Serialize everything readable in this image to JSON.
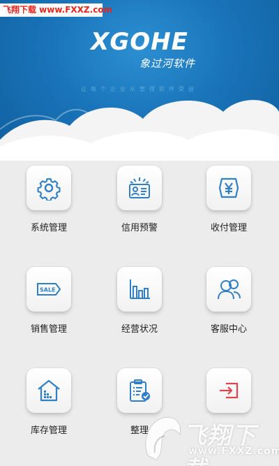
{
  "watermark_top": "飞翔下载 www.FXXZ.com",
  "header": {
    "logo": "XGOHE",
    "logo_sub": "象过河软件",
    "tagline": "让每个企业从管理软件受益"
  },
  "menu": [
    {
      "label": "系统管理",
      "icon": "gear-icon"
    },
    {
      "label": "信用预警",
      "icon": "credit-card-alert-icon"
    },
    {
      "label": "收付管理",
      "icon": "yen-payment-icon"
    },
    {
      "label": "销售管理",
      "icon": "sale-tag-icon"
    },
    {
      "label": "经营状况",
      "icon": "bar-chart-icon"
    },
    {
      "label": "客服中心",
      "icon": "customer-service-icon"
    },
    {
      "label": "库存管理",
      "icon": "warehouse-icon"
    },
    {
      "label": "整理",
      "icon": "clipboard-check-icon"
    },
    {
      "label": "",
      "icon": "logout-icon"
    }
  ],
  "watermark_bottom": {
    "text": "飞翔下载",
    "url": "www.FXXZ.com"
  },
  "colors": {
    "header_blue": "#1a74b9",
    "icon_blue": "#2f7fc6",
    "exit_red": "#e0454d",
    "background": "#ececec"
  }
}
